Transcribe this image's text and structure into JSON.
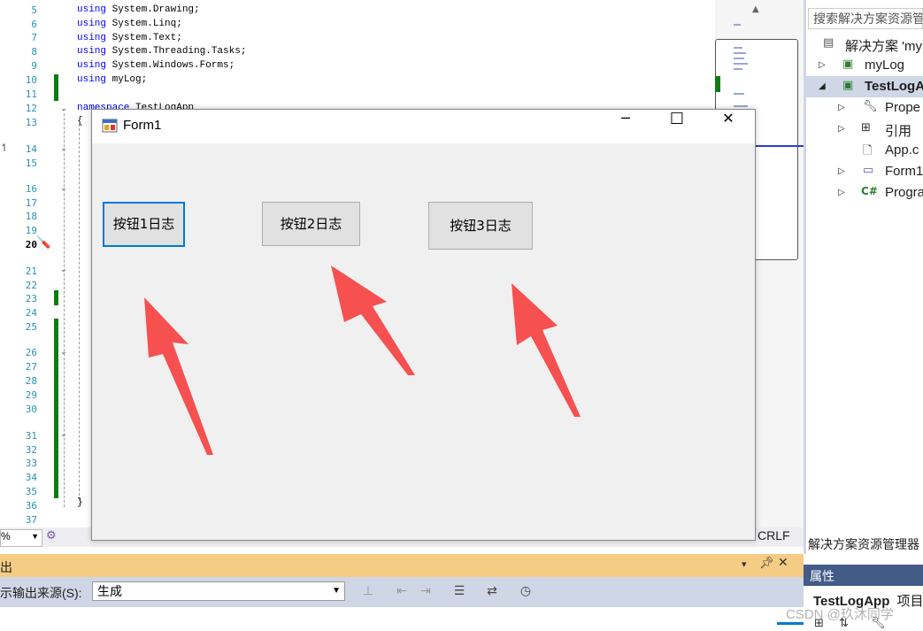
{
  "editor": {
    "line_numbers": [
      "5",
      "6",
      "7",
      "8",
      "9",
      "10",
      "11",
      "12",
      "13",
      "14",
      "15",
      "16",
      "17",
      "18",
      "19",
      "20",
      "21",
      "22",
      "23",
      "24",
      "25",
      "26",
      "27",
      "28",
      "29",
      "30",
      "31",
      "32",
      "33",
      "34",
      "35",
      "36",
      "37"
    ],
    "code_lines": [
      {
        "kw": "using",
        "rest": " System.Drawing;"
      },
      {
        "kw": "using",
        "rest": " System.Linq;"
      },
      {
        "kw": "using",
        "rest": " System.Text;"
      },
      {
        "kw": "using",
        "rest": " System.Threading.Tasks;"
      },
      {
        "kw": "using",
        "rest": " System.Windows.Forms;"
      },
      {
        "kw": "using",
        "rest": " myLog;"
      },
      {
        "kw": "",
        "rest": ""
      },
      {
        "kw": "namespace",
        "rest": " TestLogApp"
      },
      {
        "kw": "",
        "rest": "{"
      }
    ],
    "closing_brace": "}",
    "zoom": "%",
    "line_ending": "CRLF"
  },
  "output": {
    "title": "出",
    "source_label": "示输出来源(S):",
    "source_value": "生成"
  },
  "solution_explorer": {
    "search_placeholder": "搜索解决方案资源管",
    "solution_label": "解决方案 'my",
    "items": [
      {
        "label": "myLog",
        "icon": "csharp-project-icon"
      },
      {
        "label": "TestLogA",
        "icon": "csharp-project-icon"
      },
      {
        "label": "Prope",
        "icon": "wrench-icon"
      },
      {
        "label": "引用",
        "icon": "references-icon"
      },
      {
        "label": "App.c",
        "icon": "config-file-icon"
      },
      {
        "label": "Form1",
        "icon": "form-icon"
      },
      {
        "label": "Progra",
        "icon": "csharp-file-icon"
      }
    ],
    "footer": "解决方案资源管理器"
  },
  "properties": {
    "title": "属性",
    "object_name": "TestLogApp",
    "object_type": "项目"
  },
  "form1": {
    "title": "Form1",
    "buttons": [
      "按钮1日志",
      "按钮2日志",
      "按钮3日志"
    ],
    "minimize": "─",
    "maximize": "☐",
    "close": "✕"
  },
  "watermark": "CSDN @玖沐同学",
  "colors": {
    "accent_blue": "#0078d7",
    "output_header": "#f5cc84",
    "properties_header": "#425b87",
    "arrow_red": "#f75050"
  }
}
